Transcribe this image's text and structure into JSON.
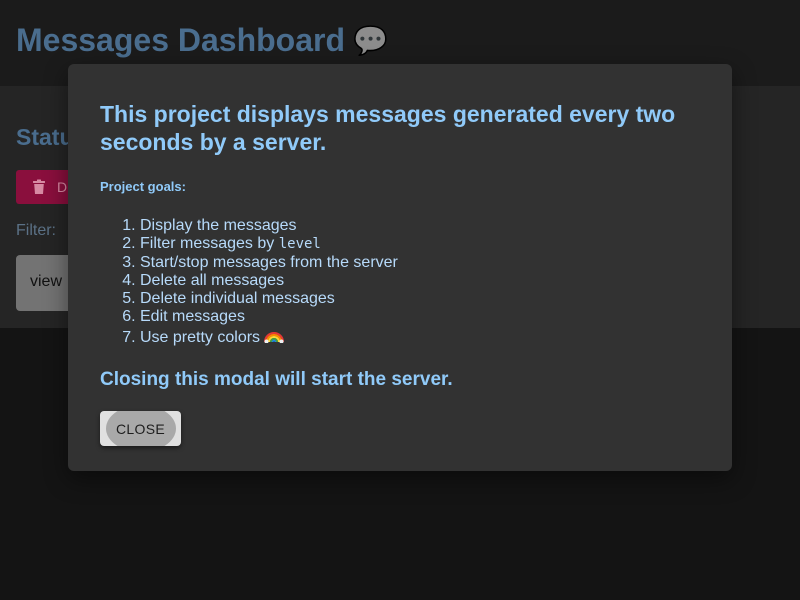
{
  "header": {
    "title": "Messages Dashboard",
    "title_icon": "speech-balloon-icon"
  },
  "controls": {
    "status_heading": "Statu",
    "delete_button_label": "D",
    "filter_label": "Filter:",
    "filter_value": "view"
  },
  "modal": {
    "heading": "This project displays messages generated every two seconds by a server.",
    "goals_label": "Project goals:",
    "goals": [
      "Display the messages",
      "Filter messages by ",
      "Start/stop messages from the server",
      "Delete all messages",
      "Delete individual messages",
      "Edit messages",
      "Use pretty colors"
    ],
    "goal_2_code": "level",
    "goal_7_icon": "rainbow-icon",
    "closing_note": "Closing this modal will start the server.",
    "close_button_label": "CLOSE"
  },
  "colors": {
    "page_background": "#141414",
    "header_background": "#1b1b1b",
    "panel_background": "#252525",
    "modal_background": "#323232",
    "modal_text": "#90caf9",
    "delete_button": "#8a0f3d",
    "close_button": "#e0e0e0"
  }
}
